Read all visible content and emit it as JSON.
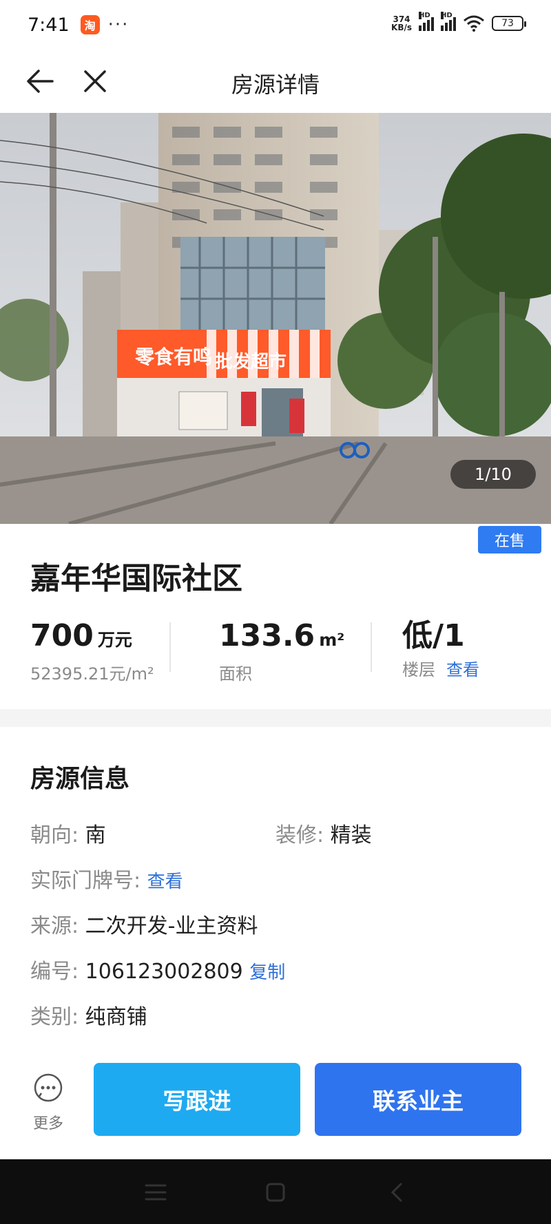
{
  "status_bar": {
    "time": "7:41",
    "app_icon_text": "淘",
    "more_dots": "···",
    "net_speed_top": "374",
    "net_speed_bottom": "KB/s",
    "sig1": "HD",
    "sig2": "HD",
    "battery": "73"
  },
  "nav": {
    "title": "房源详情",
    "back_icon": "arrow-left-icon",
    "close_icon": "close-icon"
  },
  "photo": {
    "counter": "1/10",
    "sign_text": "批发超市",
    "store_text": "零食有鸣"
  },
  "listing": {
    "status_tag": "在售",
    "title": "嘉年华国际社区",
    "price_value": "700",
    "price_unit": "万元",
    "unit_price": "52395.21元/m²",
    "area_value": "133.6",
    "area_unit": "m²",
    "area_label": "面积",
    "floor_value": "低/1",
    "floor_label": "楼层",
    "floor_link": "查看"
  },
  "info": {
    "title": "房源信息",
    "orientation_label": "朝向:",
    "orientation_value": "南",
    "decoration_label": "装修:",
    "decoration_value": "精装",
    "door_label": "实际门牌号:",
    "door_link": "查看",
    "source_label": "来源:",
    "source_value": "二次开发-业主资料",
    "id_label": "编号:",
    "id_value": "106123002809",
    "id_copy": "复制",
    "category_label": "类别:",
    "category_value": "纯商铺"
  },
  "actions": {
    "more_label": "更多",
    "follow_label": "写跟进",
    "contact_label": "联系业主"
  },
  "colors": {
    "accent_blue": "#2f74ef",
    "follow_blue": "#1eaaf1",
    "link_blue": "#2f6fd6"
  }
}
